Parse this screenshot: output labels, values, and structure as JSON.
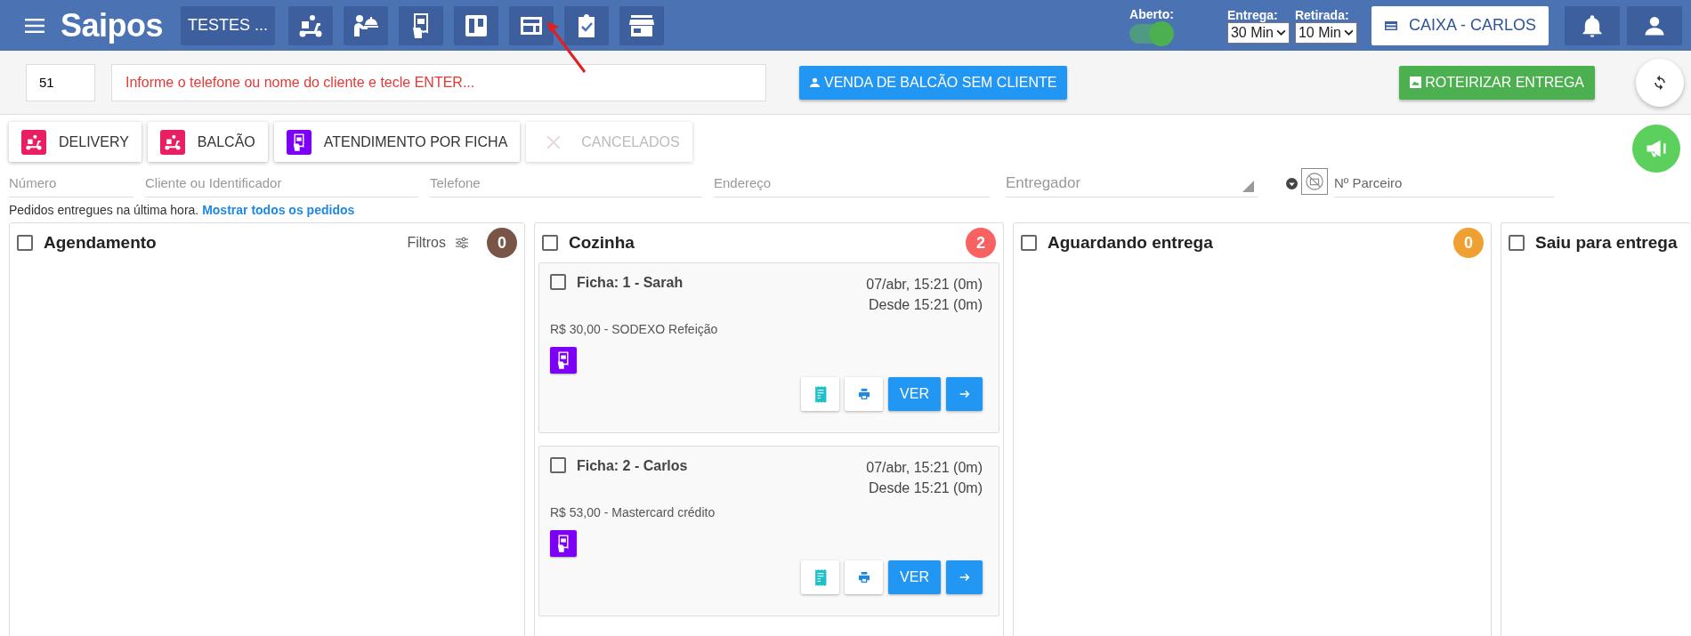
{
  "topbar": {
    "logo": "Saipos",
    "store_button": "TESTES ...",
    "nav_icons": [
      {
        "kind": "scooter"
      },
      {
        "kind": "waiter"
      },
      {
        "kind": "ticket"
      },
      {
        "kind": "board"
      },
      {
        "kind": "panel"
      },
      {
        "kind": "clipboard"
      },
      {
        "kind": "store"
      }
    ],
    "open_toggle": {
      "label": "Aberto:",
      "on": true
    },
    "selects": [
      {
        "label": "Entrega:",
        "value": "30 Min"
      },
      {
        "label": "Retirada:",
        "value": "10 Min"
      }
    ],
    "cashier_button": "CAIXA - CARLOS"
  },
  "order_bar": {
    "number_value": "51",
    "search_placeholder": "Informe o telefone ou nome do cliente e tecle ENTER...",
    "counter_button": "VENDA DE BALCÃO SEM CLIENTE",
    "route_button": "ROTEIRIZAR ENTREGA"
  },
  "channel_tabs": [
    {
      "label": "DELIVERY",
      "kind": "scooter",
      "color": "#e91e63",
      "disabled": false
    },
    {
      "label": "BALCÃO",
      "kind": "scooter",
      "color": "#e91e63",
      "disabled": false
    },
    {
      "label": "ATENDIMENTO POR FICHA",
      "kind": "ticket",
      "color": "#7b00f5",
      "disabled": false
    },
    {
      "label": "CANCELADOS",
      "kind": "close",
      "color": "#e8d9d4",
      "disabled": true
    }
  ],
  "filters": [
    {
      "placeholder": "Número",
      "kind": "text"
    },
    {
      "placeholder": "Cliente ou Identificador",
      "kind": "text"
    },
    {
      "placeholder": "Telefone",
      "kind": "text"
    },
    {
      "placeholder": "Endereço",
      "kind": "text"
    },
    {
      "placeholder": "Entregador",
      "kind": "select"
    }
  ],
  "partner_filter": {
    "placeholder": "Nº Parceiro"
  },
  "notice": {
    "text": "Pedidos entregues na última hora.",
    "link": "Mostrar todos os pedidos"
  },
  "columns": [
    {
      "title": "Agendamento",
      "checked": false,
      "filter_label": "Filtros",
      "count": "0",
      "color": "#795548"
    },
    {
      "title": "Cozinha",
      "checked": false,
      "count": "2",
      "color": "#f96262",
      "cards": [
        {
          "title": "Ficha: 1 - Sarah",
          "checked": false,
          "date": "07/abr, 15:21 (0m)",
          "since": "Desde 15:21 (0m)",
          "payment": "R$ 30,00 - SODEXO Refeição",
          "view_button": "VER"
        },
        {
          "title": "Ficha: 2 - Carlos",
          "checked": false,
          "date": "07/abr, 15:21 (0m)",
          "since": "Desde 15:21 (0m)",
          "payment": "R$ 53,00 - Mastercard crédito",
          "view_button": "VER"
        }
      ]
    },
    {
      "title": "Aguardando entrega",
      "checked": false,
      "count": "0",
      "color": "#f0a030"
    },
    {
      "title": "Saiu para entrega",
      "checked": false
    }
  ]
}
